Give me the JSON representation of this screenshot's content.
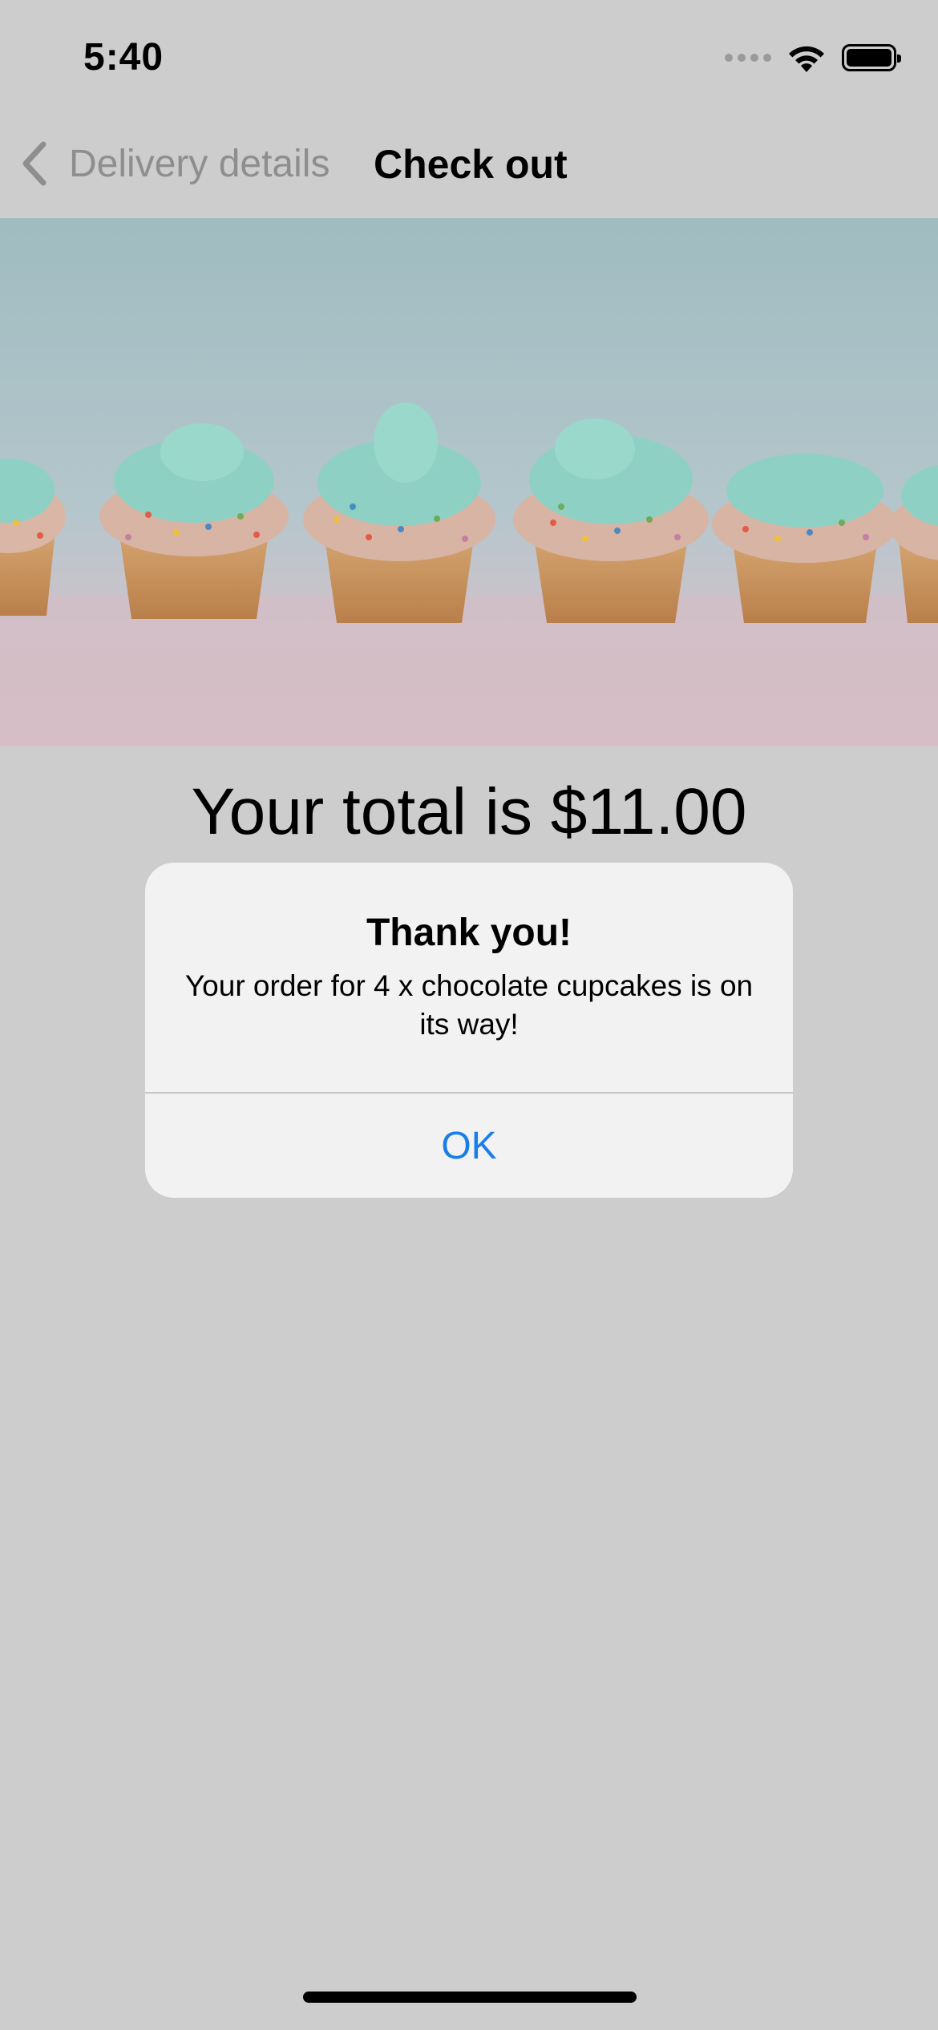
{
  "status_bar": {
    "time": "5:40"
  },
  "nav": {
    "back_label": "Delivery details",
    "title": "Check out"
  },
  "hero": {
    "image": "cupcakes-row-photo"
  },
  "total": {
    "text": "Your total is $11.00"
  },
  "alert": {
    "title": "Thank you!",
    "message": "Your order for 4 x chocolate cupcakes is on its way!",
    "ok_label": "OK"
  },
  "colors": {
    "background": "#cdcdcd",
    "alert_bg": "#f2f2f2",
    "accent": "#1a7ee8",
    "back_label": "#8e8e8e"
  }
}
